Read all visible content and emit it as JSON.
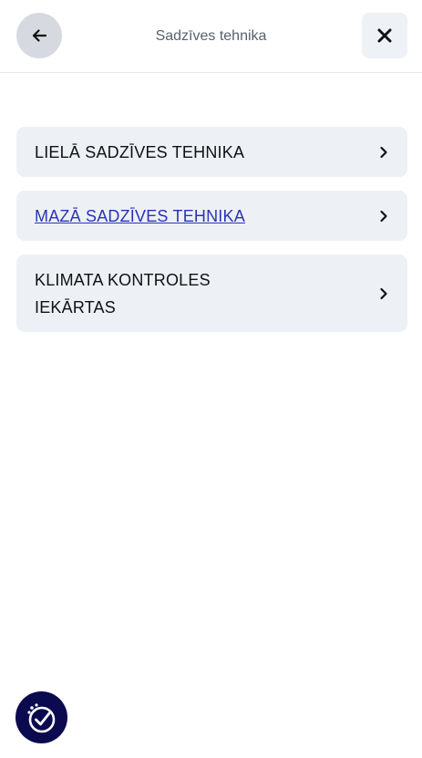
{
  "header": {
    "title": "Sadzīves tehnika",
    "back_icon": "arrow-left-icon",
    "close_icon": "close-icon"
  },
  "menu": {
    "items": [
      {
        "label": "LIELĀ SADZĪVES TEHNIKA",
        "icon": "chevron-right-icon"
      },
      {
        "label": "MAZĀ SADZĪVES TEHNIKA",
        "icon": "chevron-right-icon",
        "active": true
      },
      {
        "label": "KLIMATA KONTROLES IEKĀRTAS",
        "icon": "chevron-right-icon"
      }
    ]
  },
  "accessibility": {
    "icon": "accessibility-check-icon"
  },
  "colors": {
    "active_link": "#2a33b8",
    "item_background": "#edf1f6",
    "accessibility_background": "#0b0a4f"
  }
}
